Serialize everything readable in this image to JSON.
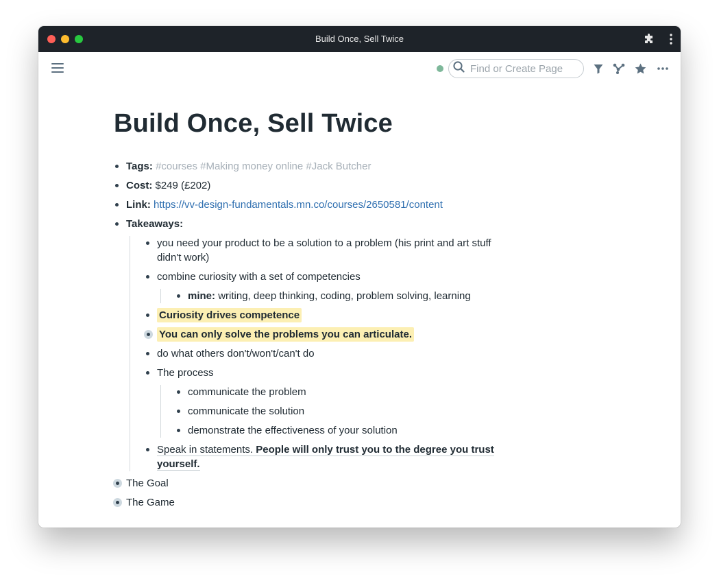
{
  "window": {
    "title": "Build Once, Sell Twice",
    "colors": {
      "titlebar": "#1e2329",
      "accent_link": "#2f6fb0",
      "highlight": "#fcefb3"
    }
  },
  "toolbar": {
    "icons": [
      "menu-icon",
      "sync-status-dot",
      "search-icon",
      "filter-icon",
      "graph-icon",
      "star-icon",
      "more-icon"
    ],
    "search_placeholder": "Find or Create Page",
    "search_value": ""
  },
  "page": {
    "title": "Build Once, Sell Twice",
    "tags_label": "Tags:",
    "tags": [
      "#courses",
      "#Making money online",
      "#Jack Butcher"
    ],
    "cost_label": "Cost:",
    "cost_value": "$249 (£202)",
    "link_label": "Link:",
    "link_url": "https://vv-design-fundamentals.mn.co/courses/2650581/content",
    "takeaways_label": "Takeaways:",
    "takeaways": {
      "t1": "you need your product to be a solution to a problem (his print and art stuff didn't work)",
      "t2": "combine curiosity with a set of competencies",
      "t2_child_label": "mine:",
      "t2_child_text": "writing, deep thinking, coding, problem solving, learning",
      "t3": "Curiosity drives competence",
      "t4": "You can only solve the problems you can articulate.",
      "t5": "do what others don't/won't/can't do",
      "t6": "The process",
      "t6_children": [
        "communicate the problem",
        "communicate the solution",
        "demonstrate the effectiveness of your solution"
      ],
      "t7_plain": "Speak in statements.",
      "t7_bold": "People will only trust you to the degree you trust yourself."
    },
    "goal": "The Goal",
    "game": "The Game"
  }
}
